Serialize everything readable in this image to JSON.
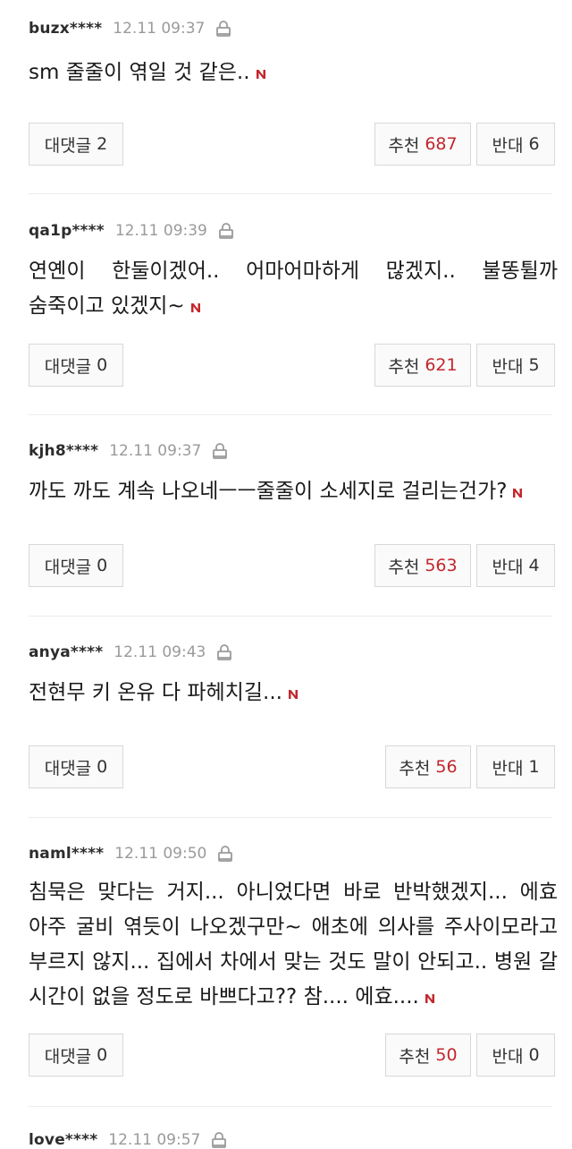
{
  "colors": {
    "accent_red": "#c2272d",
    "meta_gray": "#9a9a9a",
    "separator": "#ececec"
  },
  "labels": {
    "reply": "대댓글",
    "recommend": "추천",
    "oppose": "반대"
  },
  "icons": {
    "lock": "lock-icon",
    "new": "new-badge-icon"
  },
  "comments": [
    {
      "user": "buzx****",
      "time": "12.11 09:37",
      "text": "sm 줄줄이 엮일 것 같은..",
      "replies": "2",
      "recommend": "687",
      "oppose": "6"
    },
    {
      "user": "qa1p****",
      "time": "12.11 09:39",
      "text": "연옌이 한둘이겠어.. 어마어마하게 많겠지.. 불똥튈까 숨죽이고 있겠지~",
      "replies": "0",
      "recommend": "621",
      "oppose": "5"
    },
    {
      "user": "kjh8****",
      "time": "12.11 09:37",
      "text": "까도 까도 계속 나오네ㅡㅡ줄줄이 소세지로 걸리는건가?",
      "replies": "0",
      "recommend": "563",
      "oppose": "4"
    },
    {
      "user": "anya****",
      "time": "12.11 09:43",
      "text": "전현무 키 온유 다 파헤치길...",
      "replies": "0",
      "recommend": "56",
      "oppose": "1"
    },
    {
      "user": "naml****",
      "time": "12.11 09:50",
      "text": "침묵은 맞다는 거지... 아니었다면 바로 반박했겠지... 에효 아주 굴비 엮듯이 나오겠구만~ 애초에 의사를 주사이모라고 부르지 않지... 집에서 차에서 맞는 것도 말이 안되고.. 병원 갈 시간이 없을 정도로 바쁘다고?? 참.... 에효....",
      "replies": "0",
      "recommend": "50",
      "oppose": "0"
    },
    {
      "user": "love****",
      "time": "12.11 09:57"
    }
  ]
}
